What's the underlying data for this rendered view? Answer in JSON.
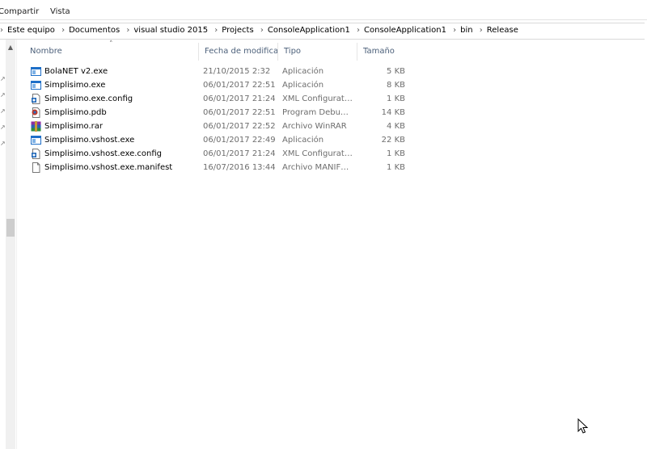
{
  "ribbon": {
    "tabs": [
      "Compartir",
      "Vista"
    ]
  },
  "address": {
    "crumbs": [
      "Este equipo",
      "Documentos",
      "visual studio 2015",
      "Projects",
      "ConsoleApplication1",
      "ConsoleApplication1",
      "bin",
      "Release"
    ]
  },
  "columns": {
    "name": "Nombre",
    "date": "Fecha de modifica...",
    "type": "Tipo",
    "size": "Tamaño"
  },
  "files": [
    {
      "name": "BolaNET v2.exe",
      "date": "21/10/2015 2:32",
      "type": "Aplicación",
      "size": "5 KB",
      "icon": "exe-icon"
    },
    {
      "name": "Simplisimo.exe",
      "date": "06/01/2017 22:51",
      "type": "Aplicación",
      "size": "8 KB",
      "icon": "exe-icon"
    },
    {
      "name": "Simplisimo.exe.config",
      "date": "06/01/2017 21:24",
      "type": "XML Configuratio...",
      "size": "1 KB",
      "icon": "config-icon"
    },
    {
      "name": "Simplisimo.pdb",
      "date": "06/01/2017 22:51",
      "type": "Program Debug D...",
      "size": "14 KB",
      "icon": "pdb-icon"
    },
    {
      "name": "Simplisimo.rar",
      "date": "06/01/2017 22:52",
      "type": "Archivo WinRAR",
      "size": "4 KB",
      "icon": "rar-icon"
    },
    {
      "name": "Simplisimo.vshost.exe",
      "date": "06/01/2017 22:49",
      "type": "Aplicación",
      "size": "22 KB",
      "icon": "exe-icon"
    },
    {
      "name": "Simplisimo.vshost.exe.config",
      "date": "06/01/2017 21:24",
      "type": "XML Configuratio...",
      "size": "1 KB",
      "icon": "config-icon"
    },
    {
      "name": "Simplisimo.vshost.exe.manifest",
      "date": "16/07/2016 13:44",
      "type": "Archivo MANIFEST",
      "size": "1 KB",
      "icon": "manifest-icon"
    }
  ],
  "colors": {
    "header_text": "#4c607a",
    "secondary_text": "#6d6d6d",
    "exe_blue": "#1e6fc8"
  }
}
